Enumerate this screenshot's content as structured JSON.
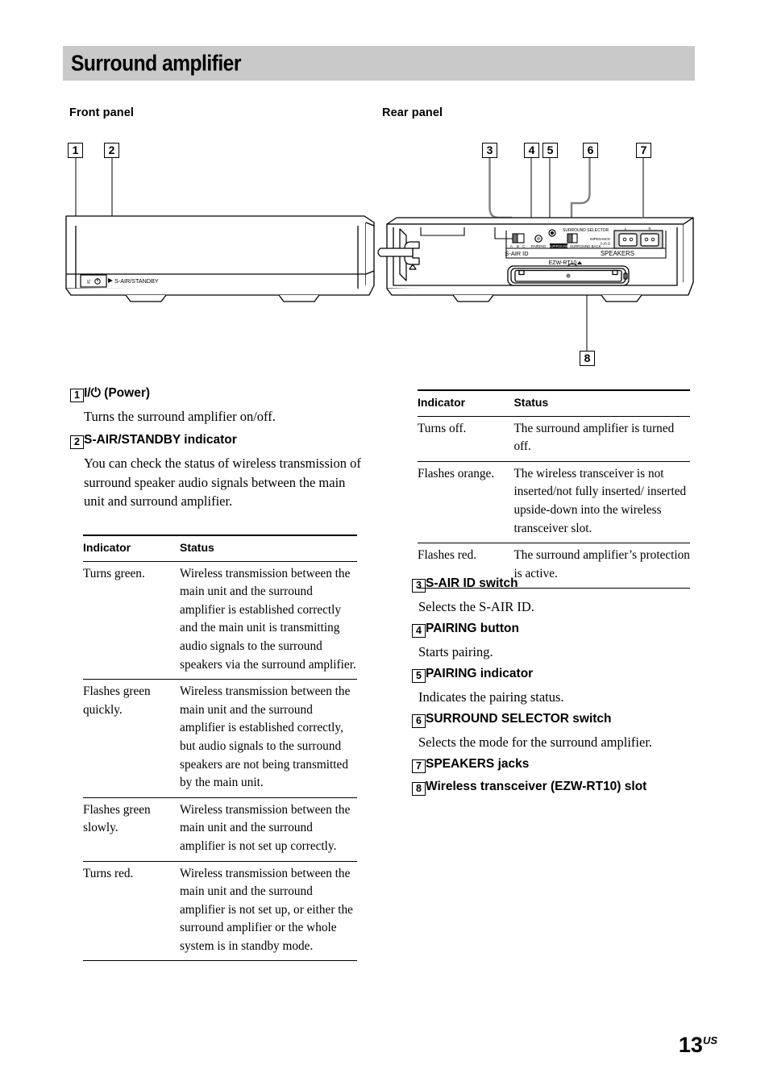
{
  "page": {
    "chapter_title": "Surround amplifier",
    "folio_number": "13",
    "folio_suffix": "US"
  },
  "sections": {
    "front_panel_heading": "Front panel",
    "rear_panel_heading": "Rear panel"
  },
  "callouts": {
    "front": [
      "1",
      "2"
    ],
    "rear": [
      "3",
      "4",
      "5",
      "6",
      "7",
      "8"
    ]
  },
  "front_panel_diagram": {
    "power_button_label": "I/⏻",
    "indicator_label": "S-AIR/STANDBY"
  },
  "rear_panel_diagram": {
    "s_air_id_group_label": "S-AIR ID",
    "s_air_id_positions": [
      "A",
      "B",
      "C"
    ],
    "pairing_label": "PAIRING",
    "surround_selector_label": "SURROUND SELECTOR",
    "surround_selector_positions": [
      "SURROUND",
      "SURROUND BACK"
    ],
    "speakers_group_label": "SPEAKERS",
    "impedance_label": "IMPEDANCE",
    "impedance_value": "3-16 Ω",
    "speaker_jack_labels": [
      "L",
      "R"
    ],
    "transceiver_slot_label": "EZW-RT10"
  },
  "items": [
    {
      "num": "1",
      "title": "I/⏻ (Power)",
      "body": "Turns the surround amplifier on/off."
    },
    {
      "num": "2",
      "title": "S-AIR/STANDBY indicator",
      "body": "You can check the status of wireless transmission of surround speaker audio signals between the main unit and surround amplifier."
    },
    {
      "num": "3",
      "title": "S-AIR ID switch",
      "body": "Selects the S-AIR ID."
    },
    {
      "num": "4",
      "title": "PAIRING button",
      "body": "Starts pairing."
    },
    {
      "num": "5",
      "title": "PAIRING indicator",
      "body": "Indicates the pairing status."
    },
    {
      "num": "6",
      "title": "SURROUND SELECTOR switch",
      "body": "Selects the mode for the surround amplifier."
    },
    {
      "num": "7",
      "title": "SPEAKERS jacks",
      "body": ""
    },
    {
      "num": "8",
      "title": "Wireless transceiver (EZW-RT10) slot",
      "body": ""
    }
  ],
  "indicator_table_left": {
    "headers": [
      "Indicator",
      "Status"
    ],
    "rows": [
      {
        "indicator": "Turns green.",
        "status": "Wireless transmission between the main unit and the surround amplifier is established correctly and the main unit is transmitting audio signals to the surround speakers via the surround amplifier."
      },
      {
        "indicator": "Flashes green quickly.",
        "status": "Wireless transmission between the main unit and the surround amplifier is established correctly, but audio signals to the surround speakers are not being transmitted by the main unit."
      },
      {
        "indicator": "Flashes green slowly.",
        "status": "Wireless transmission between the main unit and the surround amplifier is not set up correctly."
      },
      {
        "indicator": "Turns red.",
        "status": "Wireless transmission between the main unit and the surround amplifier is not set up, or either the surround amplifier or the whole system is in standby mode."
      }
    ]
  },
  "indicator_table_right": {
    "headers": [
      "Indicator",
      "Status"
    ],
    "rows": [
      {
        "indicator": "Turns off.",
        "status": "The surround amplifier is turned off."
      },
      {
        "indicator": "Flashes orange.",
        "status": "The wireless transceiver is not inserted/not fully inserted/ inserted upside-down into the wireless transceiver slot."
      },
      {
        "indicator": "Flashes red.",
        "status": "The surround amplifier’s protection is active."
      }
    ]
  },
  "colors": {
    "header_bar": "#c9c9c9",
    "leader_line": "#808080",
    "text": "#000000"
  }
}
